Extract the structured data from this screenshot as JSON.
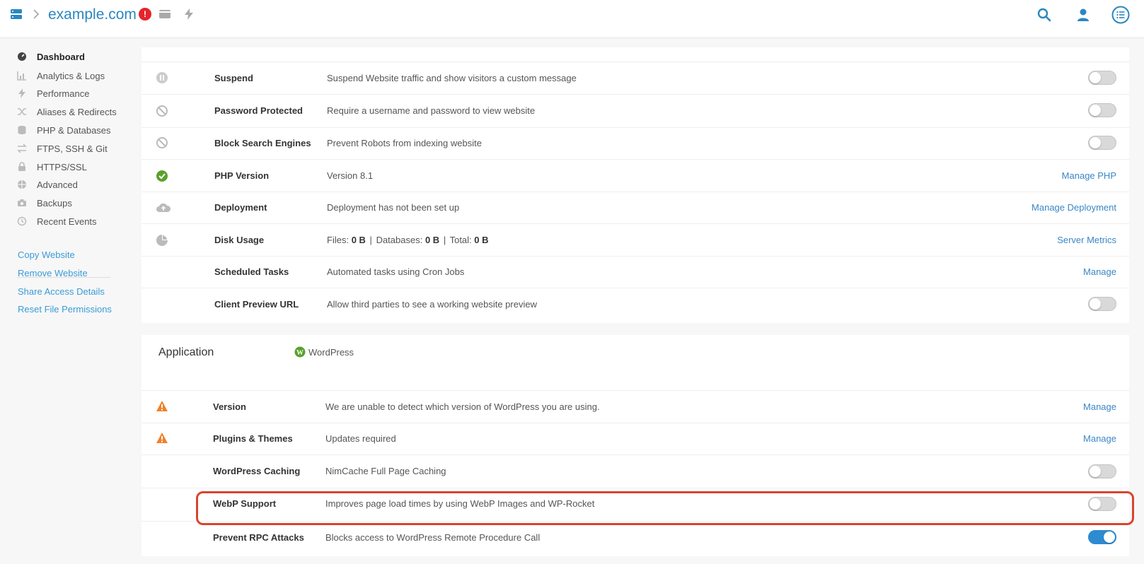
{
  "topbar": {
    "domain": "example.com",
    "alert_badge": "!",
    "icons": [
      "server-icon",
      "chevron-right-icon",
      "alert-icon",
      "card-icon",
      "bolt-icon",
      "search-icon",
      "user-icon",
      "menu-list-icon"
    ]
  },
  "sidebar": {
    "items": [
      {
        "label": "Dashboard",
        "icon": "dashboard-icon",
        "active": true
      },
      {
        "label": "Analytics & Logs",
        "icon": "chart-icon"
      },
      {
        "label": "Performance",
        "icon": "bolt-icon"
      },
      {
        "label": "Aliases & Redirects",
        "icon": "shuffle-icon"
      },
      {
        "label": "PHP & Databases",
        "icon": "database-icon"
      },
      {
        "label": "FTPS, SSH & Git",
        "icon": "transfer-icon"
      },
      {
        "label": "HTTPS/SSL",
        "icon": "lock-icon"
      },
      {
        "label": "Advanced",
        "icon": "globe-icon"
      },
      {
        "label": "Backups",
        "icon": "camera-icon"
      },
      {
        "label": "Recent Events",
        "icon": "history-icon"
      }
    ],
    "links": [
      "Copy Website",
      "Remove Website",
      "Share Access Details",
      "Reset File Permissions"
    ]
  },
  "settings": {
    "rows": [
      {
        "name": "Suspend",
        "desc": "Suspend Website traffic and show visitors a custom message",
        "icon": "pause-icon",
        "toggle": false
      },
      {
        "name": "Password Protected",
        "desc": "Require a username and password to view website",
        "icon": "blocked-icon",
        "toggle": false
      },
      {
        "name": "Block Search Engines",
        "desc": "Prevent Robots from indexing website",
        "icon": "blocked-icon",
        "toggle": false
      },
      {
        "name": "PHP Version",
        "desc": "Version 8.1",
        "icon": "check-circle-icon",
        "action": "Manage PHP"
      },
      {
        "name": "Deployment",
        "desc": "Deployment has not been set up",
        "icon": "cloud-upload-icon",
        "action": "Manage Deployment"
      },
      {
        "name": "Disk Usage",
        "icon": "pie-chart-icon",
        "action": "Server Metrics"
      },
      {
        "name": "Scheduled Tasks",
        "desc": "Automated tasks using Cron Jobs",
        "action": "Manage"
      },
      {
        "name": "Client Preview URL",
        "desc": "Allow third parties to see a working website preview",
        "toggle": false
      }
    ],
    "disk_usage": {
      "files_label": "Files:",
      "files_value": "0 B",
      "db_label": "Databases:",
      "db_value": "0 B",
      "total_label": "Total:",
      "total_value": "0 B",
      "separator": "|"
    }
  },
  "application": {
    "title": "Application",
    "type": "WordPress",
    "rows": [
      {
        "name": "Version",
        "desc": "We are unable to detect which version of WordPress you are using.",
        "icon": "warning-icon",
        "action": "Manage"
      },
      {
        "name": "Plugins & Themes",
        "desc": "Updates required",
        "icon": "warning-icon",
        "action": "Manage"
      },
      {
        "name": "WordPress Caching",
        "desc": "NimCache Full Page Caching",
        "toggle": false
      },
      {
        "name": "WebP Support",
        "desc": "Improves page load times by using WebP Images and WP-Rocket",
        "toggle": false,
        "highlighted": true
      },
      {
        "name": "Prevent RPC Attacks",
        "desc": "Blocks access to WordPress Remote Procedure Call",
        "toggle": true
      }
    ]
  },
  "colors": {
    "accent": "#2b87c0",
    "link": "#3a9bd8",
    "toggle_on": "#2d8bd1",
    "success": "#5aa02c",
    "warning": "#f0812a",
    "alert": "#e5242b",
    "highlight_border": "#d9452e"
  }
}
